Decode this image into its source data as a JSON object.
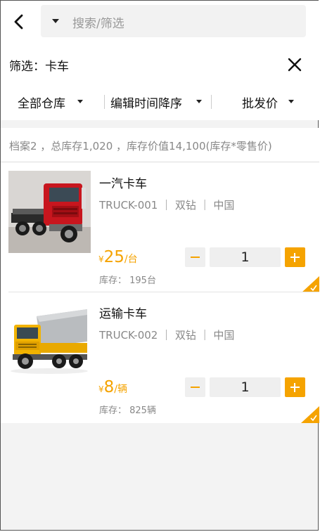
{
  "header": {
    "search_placeholder": "搜索/筛选"
  },
  "filter": {
    "label": "筛选：卡车"
  },
  "tabs": [
    {
      "label": "全部仓库"
    },
    {
      "label": "编辑时间降序"
    },
    {
      "label": "批发价"
    }
  ],
  "summary": {
    "text": "档案2 ，总库存1,020 ，库存价值14,100(库存*零售价)"
  },
  "products": [
    {
      "name": "一汽卡车",
      "meta": "TRUCK-001 ｜ 双钻 ｜ 中国",
      "currency": "¥",
      "price": "25",
      "unit": "/台",
      "stock": "库存： 195台",
      "qty": "1",
      "image_icon": "red-truck-photo"
    },
    {
      "name": "运输卡车",
      "meta": "TRUCK-002 ｜ 双钻 ｜ 中国",
      "currency": "¥",
      "price": "8",
      "unit": "/辆",
      "stock": "库存： 825辆",
      "qty": "1",
      "image_icon": "yellow-dump-truck-photo"
    }
  ],
  "colors": {
    "accent": "#f5a300",
    "muted_text": "#888888",
    "background": "#f3f3f3"
  }
}
